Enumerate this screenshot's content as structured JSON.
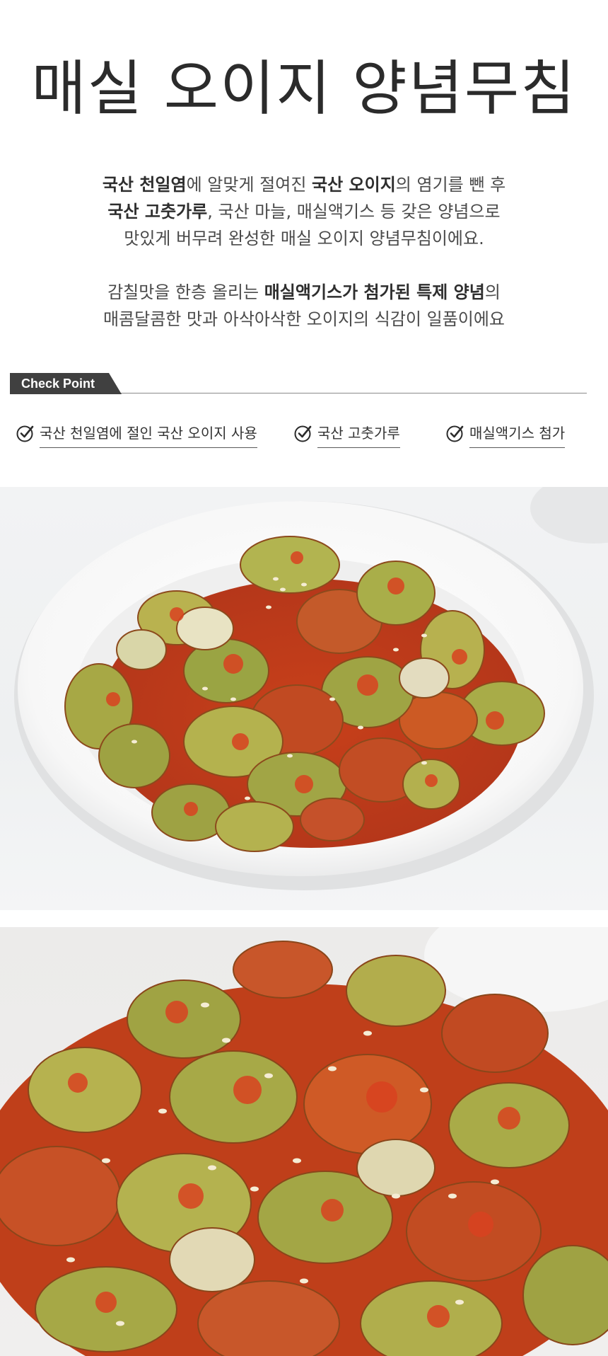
{
  "title": "매실 오이지 양념무침",
  "description": {
    "p1_l1_b1": "국산 천일염",
    "p1_l1_t1": "에 알맞게 절여진 ",
    "p1_l1_b2": "국산 오이지",
    "p1_l1_t2": "의 염기를 뺀 후",
    "p1_l2_b1": "국산 고춧가루",
    "p1_l2_t1": ", 국산 마늘, 매실액기스 등 갖은 양념으로",
    "p1_l3": "맛있게 버무려 완성한 매실 오이지 양념무침이에요.",
    "p2_l1_t1": "감칠맛을 한층 올리는 ",
    "p2_l1_b1": "매실액기스가 첨가된 특제 양념",
    "p2_l1_t2": "의",
    "p2_l2": "매콤달콤한 맛과 아삭아삭한 오이지의 식감이 일품이에요"
  },
  "checkpoint": {
    "tag": "Check Point",
    "items": [
      {
        "label": "국산 천일염에 절인 국산 오이지 사용",
        "icon": "check-circle-icon"
      },
      {
        "label": "국산 고춧가루",
        "icon": "check-circle-icon"
      },
      {
        "label": "매실액기스 첨가",
        "icon": "check-circle-icon"
      }
    ]
  },
  "colors": {
    "tag_bg": "#404040",
    "tag_text": "#ffffff",
    "text": "#333333",
    "sauce": "#d2461e",
    "cucumber": "#a9b24a"
  }
}
